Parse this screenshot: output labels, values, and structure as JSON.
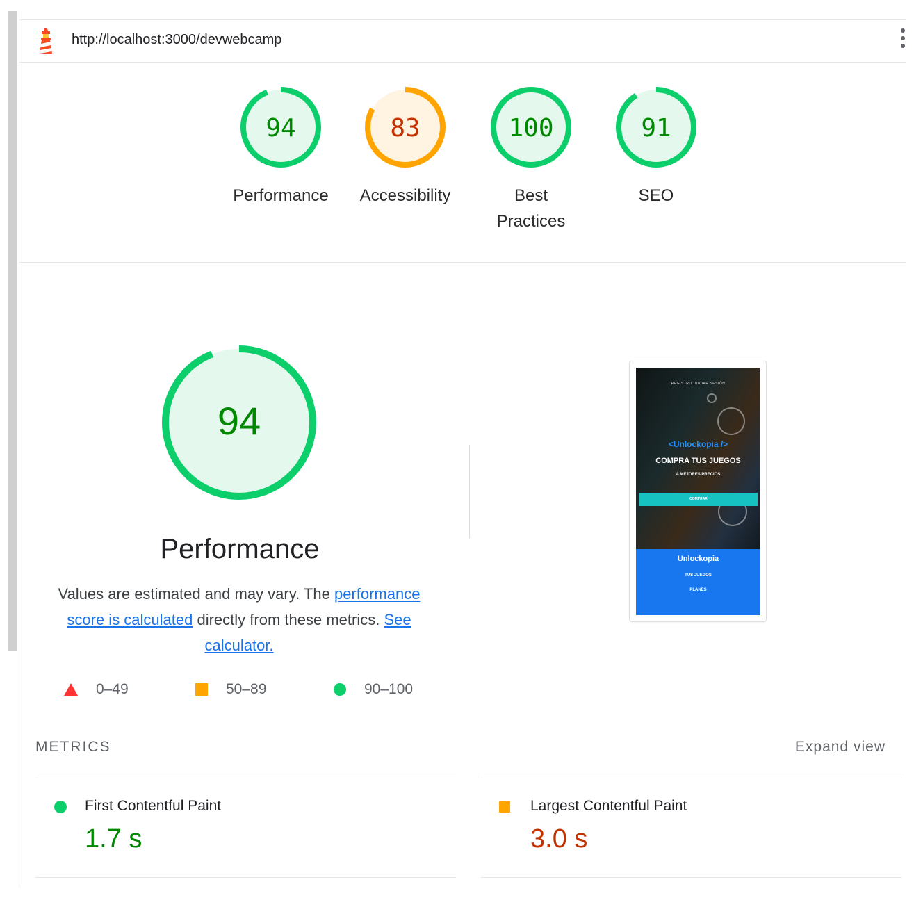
{
  "header": {
    "url": "http://localhost:3000/devwebcamp",
    "logo_icon": "lighthouse-icon",
    "menu_icon": "kebab-menu-icon"
  },
  "gauges": [
    {
      "score": "94",
      "score_fraction": 0.94,
      "label": "Performance",
      "color": "#0cce6b",
      "text_color": "#008800",
      "fill": "#e5f8ee"
    },
    {
      "score": "83",
      "score_fraction": 0.83,
      "label": "Accessibility",
      "color": "#ffa400",
      "text_color": "#c33300",
      "fill": "#fff3e2"
    },
    {
      "score": "100",
      "score_fraction": 1.0,
      "label": "Best Practices",
      "color": "#0cce6b",
      "text_color": "#008800",
      "fill": "#e5f8ee"
    },
    {
      "score": "91",
      "score_fraction": 0.91,
      "label": "SEO",
      "color": "#0cce6b",
      "text_color": "#008800",
      "fill": "#e5f8ee"
    }
  ],
  "performance": {
    "score": "94",
    "score_fraction": 0.94,
    "title": "Performance",
    "desc_part1": "Values are estimated and may vary. The ",
    "link1": "performance score is calculated",
    "desc_part2": " directly from these metrics. ",
    "link2": "See calculator.",
    "legend": [
      {
        "shape": "triangle",
        "range": "0–49",
        "color": "#ff3333"
      },
      {
        "shape": "square",
        "range": "50–89",
        "color": "#ffa400"
      },
      {
        "shape": "circle",
        "range": "90–100",
        "color": "#0cce6b"
      }
    ]
  },
  "screenshot": {
    "nav": "REGISTRO   INICIAR SESIÓN",
    "brand": "<Unlockopia />",
    "title": "COMPRA TUS JUEGOS",
    "subtitle": "A MEJORES PRECIOS",
    "button": "COMPRAR",
    "footer_brand": "Unlockopia",
    "footer_items": [
      "TUS JUEGOS",
      "PLANES"
    ]
  },
  "metrics": {
    "title": "METRICS",
    "expand": "Expand view",
    "items": [
      {
        "name": "First Contentful Paint",
        "value": "1.7 s",
        "status": "pass",
        "color": "#008800"
      },
      {
        "name": "Largest Contentful Paint",
        "value": "3.0 s",
        "status": "average",
        "color": "#c33300"
      }
    ]
  }
}
